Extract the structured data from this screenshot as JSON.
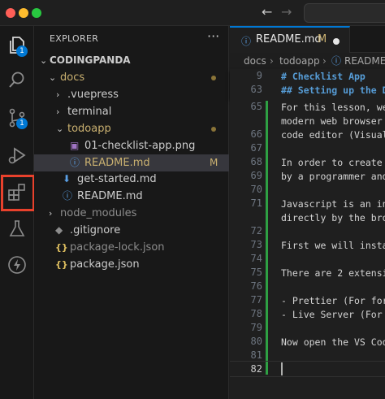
{
  "explorer": {
    "title": "EXPLORER",
    "more": "···",
    "root": "CODINGPANDA",
    "items": [
      {
        "label": "docs",
        "chev": "⌄",
        "icon": "",
        "color": "#c9b070",
        "dot": true,
        "m": ""
      },
      {
        "label": ".vuepress",
        "chev": "›",
        "icon": "",
        "color": "#cccccc",
        "dot": false,
        "m": ""
      },
      {
        "label": "terminal",
        "chev": "›",
        "icon": "",
        "color": "#cccccc",
        "dot": false,
        "m": ""
      },
      {
        "label": "todoapp",
        "chev": "⌄",
        "icon": "",
        "color": "#c9b070",
        "dot": true,
        "m": ""
      },
      {
        "label": "01-checklist-app.png",
        "chev": "",
        "icon": "image-icon",
        "color": "#cccccc",
        "dot": false,
        "m": ""
      },
      {
        "label": "README.md",
        "chev": "",
        "icon": "info-icon",
        "color": "#c9b070",
        "dot": false,
        "m": "M"
      },
      {
        "label": "get-started.md",
        "chev": "",
        "icon": "download-icon",
        "color": "#cccccc",
        "dot": false,
        "m": ""
      },
      {
        "label": "README.md",
        "chev": "",
        "icon": "info-icon",
        "color": "#cccccc",
        "dot": false,
        "m": ""
      },
      {
        "label": "node_modules",
        "chev": "›",
        "icon": "",
        "color": "#8c8c8c",
        "dot": false,
        "m": ""
      },
      {
        "label": ".gitignore",
        "chev": "",
        "icon": "git-icon",
        "color": "#cccccc",
        "dot": false,
        "m": ""
      },
      {
        "label": "package-lock.json",
        "chev": "",
        "icon": "json-icon",
        "color": "#8c8c8c",
        "dot": false,
        "m": ""
      },
      {
        "label": "package.json",
        "chev": "",
        "icon": "json-icon",
        "color": "#cccccc",
        "dot": false,
        "m": ""
      }
    ]
  },
  "activity": {
    "explorer_badge": "1",
    "scm_badge": "1"
  },
  "tab": {
    "name": "README.md",
    "modified": "M"
  },
  "breadcrumb": [
    "docs",
    "todoapp",
    "README.m"
  ],
  "sticky": [
    {
      "num": "9",
      "text": "# Checklist App"
    },
    {
      "num": "63",
      "text": "## Setting up the D"
    }
  ],
  "code": [
    {
      "num": "65",
      "text": "For this lesson, we"
    },
    {
      "num": "",
      "text": "modern web browser"
    },
    {
      "num": "66",
      "text": "code editor (Visual"
    },
    {
      "num": "67",
      "text": ""
    },
    {
      "num": "68",
      "text": "In order to create"
    },
    {
      "num": "69",
      "text": "by a programmer and"
    },
    {
      "num": "70",
      "text": ""
    },
    {
      "num": "71",
      "text": "Javascript is an in"
    },
    {
      "num": "",
      "text": "directly by the bro"
    },
    {
      "num": "72",
      "text": ""
    },
    {
      "num": "73",
      "text": "First we will insta"
    },
    {
      "num": "74",
      "text": ""
    },
    {
      "num": "75",
      "text": "There are 2 extensi"
    },
    {
      "num": "76",
      "text": ""
    },
    {
      "num": "77",
      "text": "- Prettier (For for"
    },
    {
      "num": "78",
      "text": "- Live Server (For"
    },
    {
      "num": "79",
      "text": ""
    },
    {
      "num": "80",
      "text": "Now open the VS Coo"
    },
    {
      "num": "81",
      "text": ""
    },
    {
      "num": "82",
      "text": ""
    }
  ],
  "colors": {
    "accent": "#0078d4",
    "highlight": "#e8412c",
    "modified": "#c9b070",
    "heading": "#569cd6"
  }
}
